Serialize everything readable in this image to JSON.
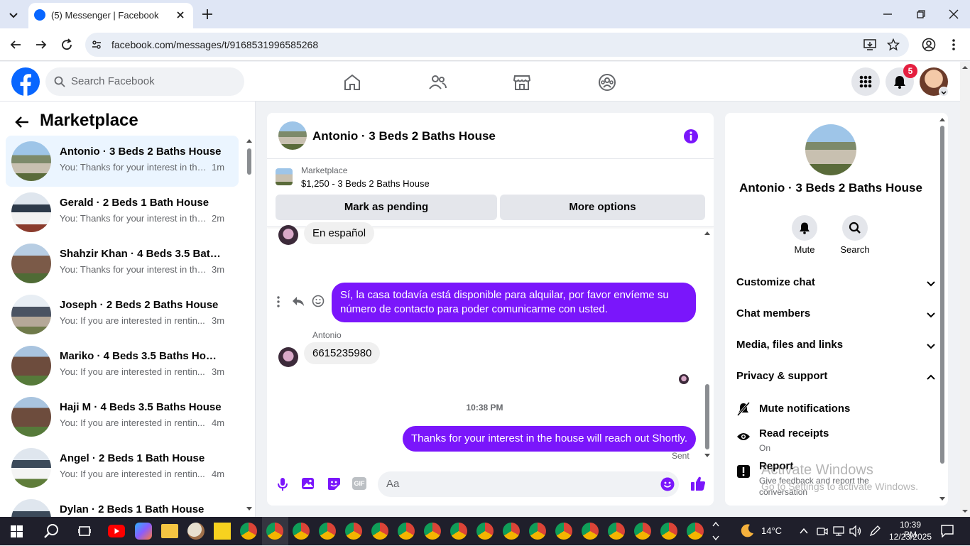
{
  "browser": {
    "tab_title": "(5) Messenger | Facebook",
    "url": "facebook.com/messages/t/9168531996585268"
  },
  "header": {
    "search_placeholder": "Search Facebook",
    "notification_count": "5",
    "brand_color": "#0866ff"
  },
  "sidebar": {
    "title": "Marketplace",
    "conversations": [
      {
        "title": "Antonio · 3 Beds 2 Baths House",
        "snippet": "You: Thanks for your interest in the...",
        "time": "1m",
        "active": true
      },
      {
        "title": "Gerald · 2 Beds 1 Bath House",
        "snippet": "You: Thanks for your interest in the...",
        "time": "2m"
      },
      {
        "title": "Shahzir Khan · 4 Beds 3.5 Baths ...",
        "snippet": "You: Thanks for your interest in the...",
        "time": "3m"
      },
      {
        "title": "Joseph · 2 Beds 2 Baths House",
        "snippet": "You: If you are interested in rentin...",
        "time": "3m"
      },
      {
        "title": "Mariko · 4 Beds 3.5 Baths House",
        "snippet": "You: If you are interested in rentin...",
        "time": "3m"
      },
      {
        "title": "Haji M · 4 Beds 3.5 Baths House",
        "snippet": "You: If you are interested in rentin...",
        "time": "4m"
      },
      {
        "title": "Angel · 2 Beds 1 Bath House",
        "snippet": "You: If you are interested in rentin...",
        "time": "4m"
      },
      {
        "title": "Dylan · 2 Beds 1 Bath House",
        "snippet": "",
        "time": ""
      }
    ]
  },
  "chat": {
    "title": "Antonio · 3 Beds 2 Baths House",
    "listing_label": "Marketplace",
    "listing_desc": "$1,250 - 3 Beds 2 Baths House",
    "mark_pending": "Mark as pending",
    "more_options": "More options",
    "msg_en_espanol": "En español",
    "msg_out_1": "Sí, la casa todavía está disponible para alquilar, por favor envíeme su número de contacto para poder comunicarme con usted.",
    "sender_name": "Antonio",
    "msg_in_phone": "6615235980",
    "timestamp": "10:38 PM",
    "msg_out_2": "Thanks for your interest in the house will reach out Shortly.",
    "sent_status": "Sent",
    "composer_placeholder": "Aa",
    "accent_color": "#7a16fb"
  },
  "details": {
    "title": "Antonio · 3 Beds 2 Baths House",
    "mute_label": "Mute",
    "search_label": "Search",
    "customize_chat": "Customize chat",
    "chat_members": "Chat members",
    "media_files": "Media, files and links",
    "privacy_support": "Privacy & support",
    "mute_notifications": "Mute notifications",
    "read_receipts": "Read receipts",
    "read_receipts_state": "On",
    "report": "Report",
    "report_desc": "Give feedback and report the conversation"
  },
  "watermark": {
    "line1": "Activate Windows",
    "line2": "Go to Settings to activate Windows."
  },
  "taskbar": {
    "weather": "14°C",
    "time": "10:39 PM",
    "date": "12/23/2025"
  }
}
